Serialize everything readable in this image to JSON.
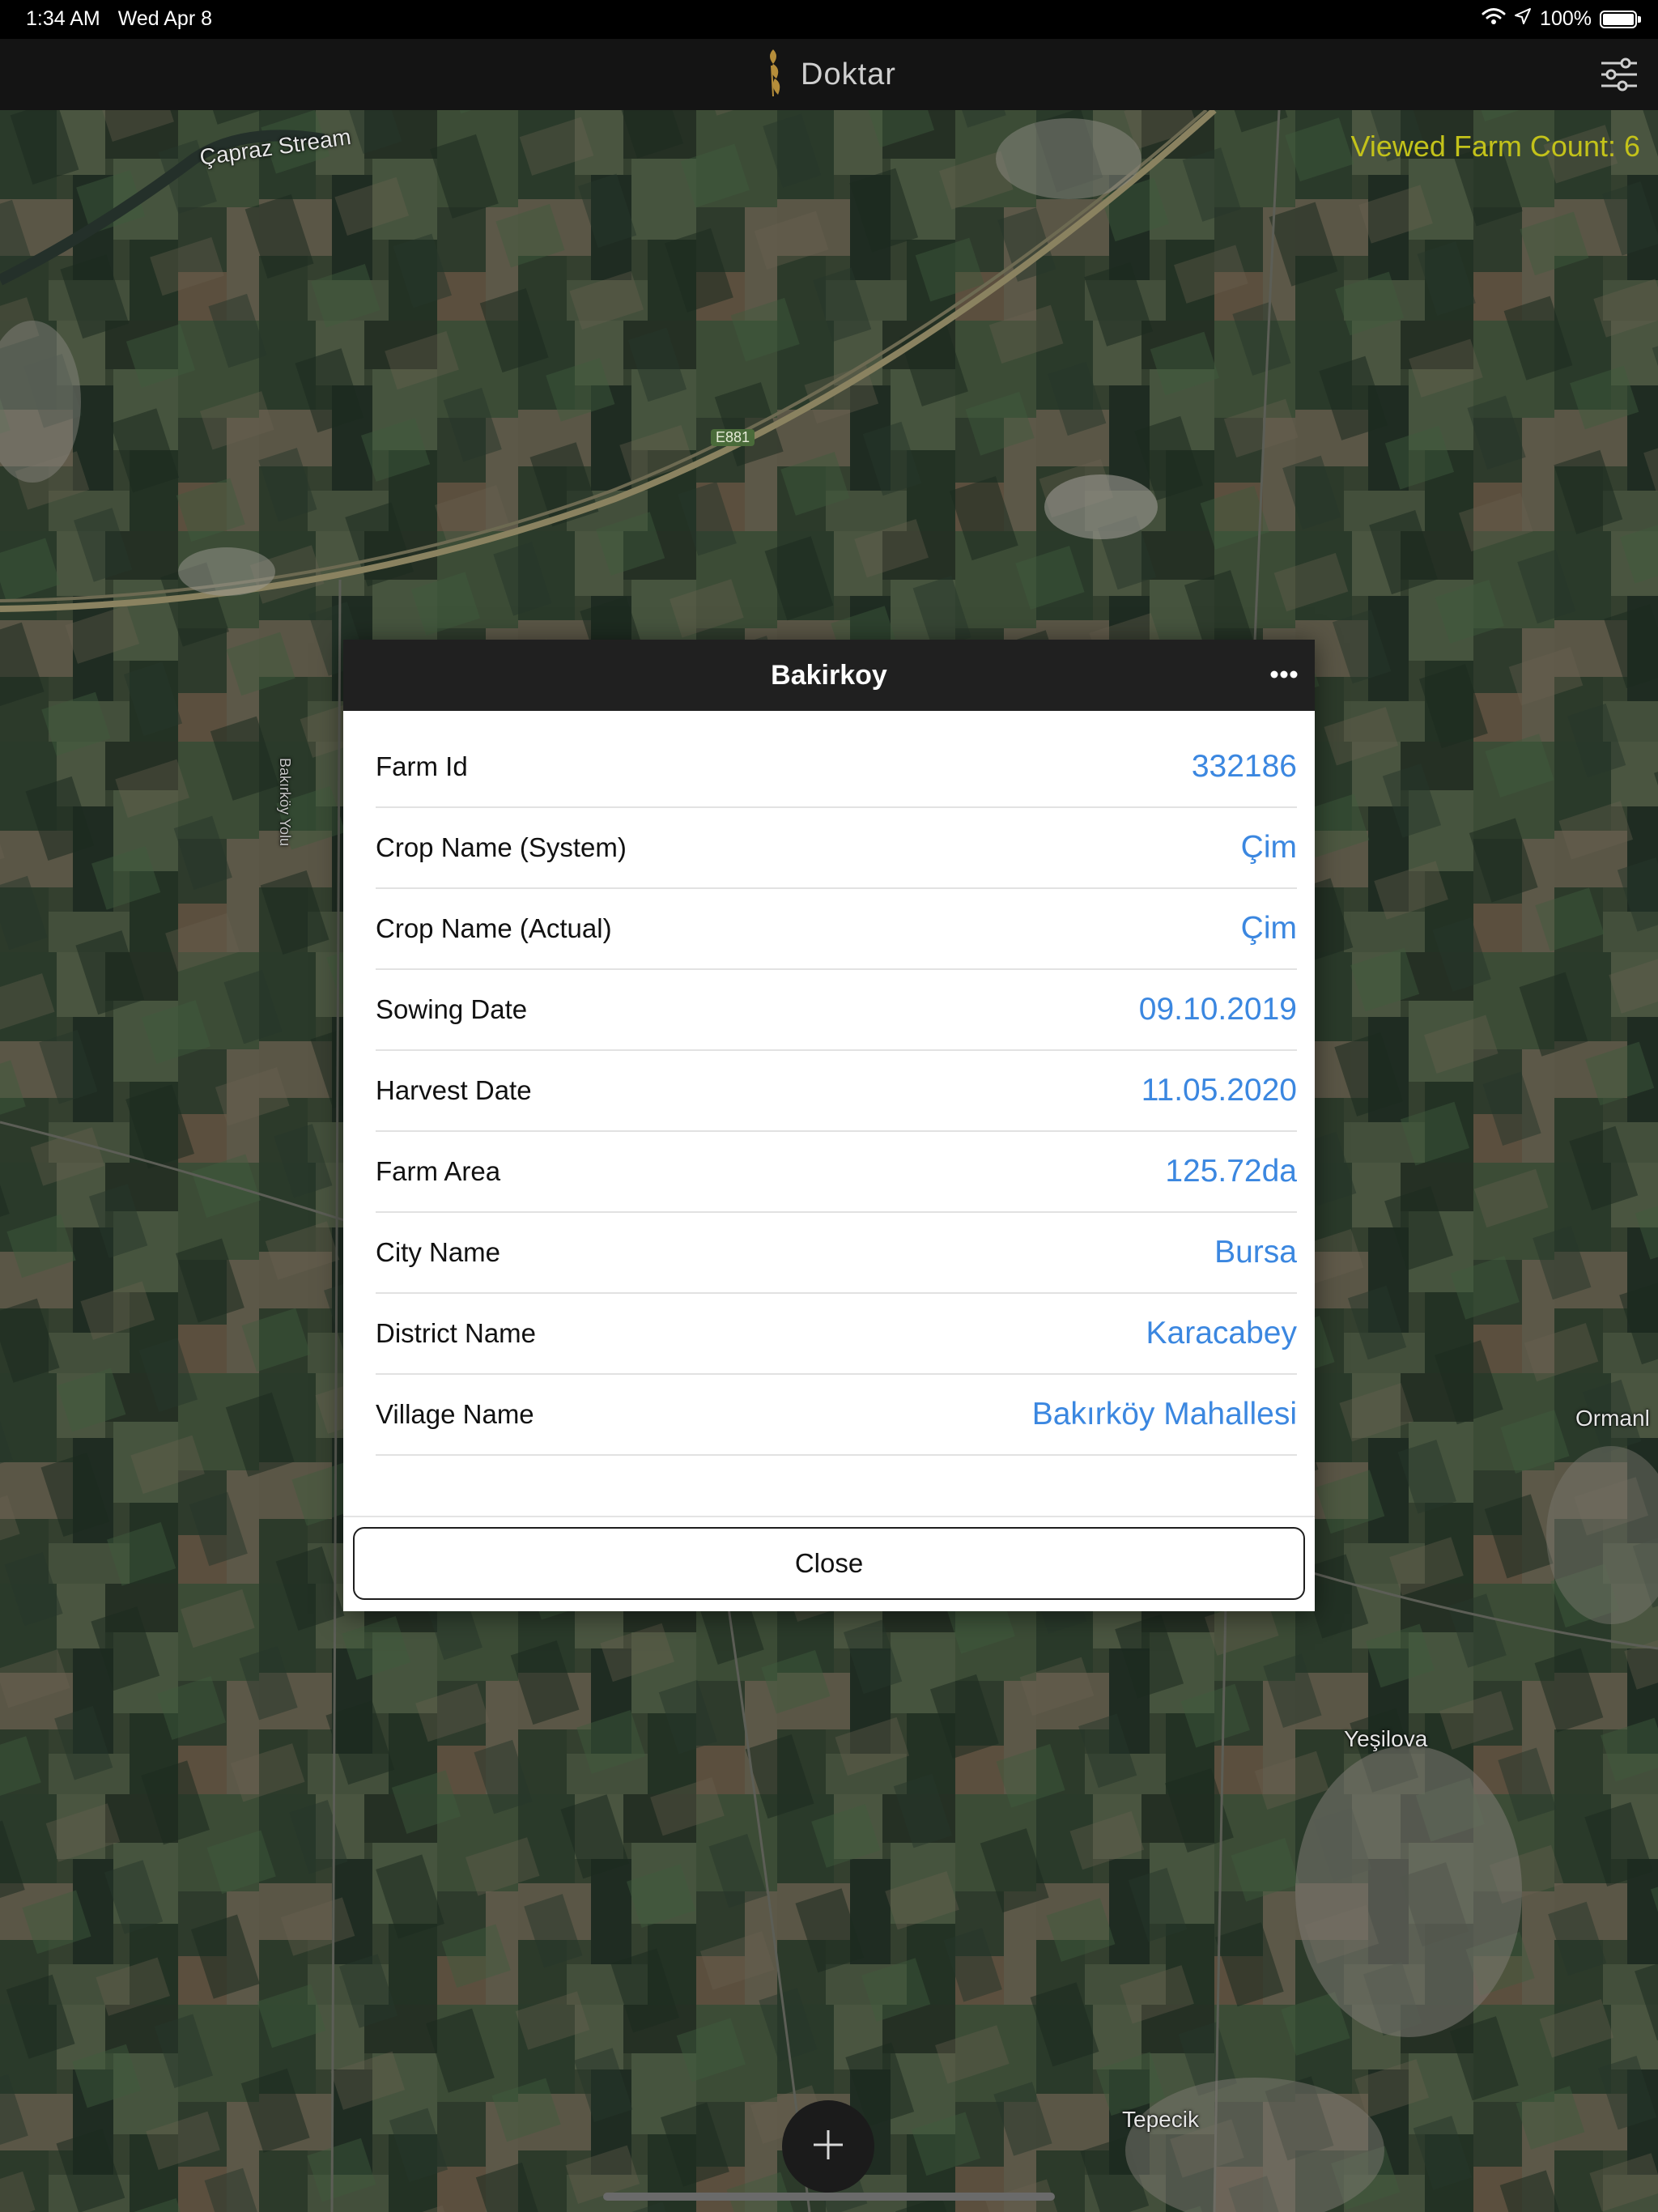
{
  "status_bar": {
    "time": "1:34 AM",
    "date": "Wed Apr 8",
    "battery": "100%",
    "battery_level": 1.0,
    "icons": [
      "wifi-icon",
      "location-arrow-icon",
      "battery-icon"
    ]
  },
  "nav": {
    "title": "Doktar",
    "logo_icon": "wheat-logo-icon",
    "filter_icon": "sliders-icon"
  },
  "map": {
    "viewed_label": "Viewed Farm Count: 6",
    "labels": {
      "stream": "Çapraz Stream",
      "road_sign": "E881",
      "road_name": "Bakırköy Yolu",
      "town_1": "Ormanl",
      "town_2": "Yeşilova",
      "town_3": "Tepecik"
    }
  },
  "dialog": {
    "title": "Bakirkoy",
    "more_icon": "ellipsis-icon",
    "rows": [
      {
        "label": "Farm Id",
        "value": "332186"
      },
      {
        "label": "Crop Name (System)",
        "value": "Çim"
      },
      {
        "label": "Crop Name (Actual)",
        "value": "Çim"
      },
      {
        "label": "Sowing Date",
        "value": "09.10.2019"
      },
      {
        "label": "Harvest Date",
        "value": "11.05.2020"
      },
      {
        "label": "Farm Area",
        "value": "125.72da"
      },
      {
        "label": "City Name",
        "value": "Bursa"
      },
      {
        "label": "District Name",
        "value": "Karacabey"
      },
      {
        "label": "Village Name",
        "value": "Bakırköy Mahallesi"
      }
    ],
    "close_label": "Close"
  },
  "fab": {
    "icon": "plus-icon"
  },
  "colors": {
    "accent_value": "#3b87e0",
    "viewed_count": "#c3c21a",
    "header_bg": "#202020",
    "nav_bg": "#141414"
  }
}
